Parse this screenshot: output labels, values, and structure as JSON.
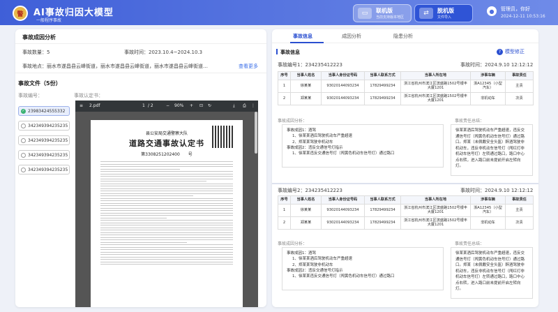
{
  "app": {
    "title": "AI事故归因大模型",
    "subtitle": "一般程序事故",
    "logo_text": "警"
  },
  "modes": [
    {
      "name": "联机版",
      "desc": "当前支持版本地区"
    },
    {
      "name": "脱机版",
      "desc": "文件导入"
    }
  ],
  "user": {
    "name": "管理员，你好",
    "time": "2024-12-11 10:53:16"
  },
  "left": {
    "title": "事故成因分析",
    "count_label": "事故数量：",
    "count_value": "5",
    "time_label": "事故时间：",
    "time_value": "2023.10.4~2024.10.3",
    "place_label": "事故地点：",
    "place_value": "丽水市遂昌县云峰街道，丽水市遂昌县云峰街道，丽水市遂昌县云峰街道…",
    "more": "查看更多",
    "files_title": "事故文件（5份）",
    "case_no_label": "事故编号：",
    "cert_label": "事故认定书：",
    "cases": [
      "23983424555332",
      "342349394235235",
      "342349394235235",
      "342349394235235",
      "342349394235235"
    ]
  },
  "viewer": {
    "filename": "2.pdf",
    "page": "1",
    "pages": "/ 2",
    "zoom": "90%",
    "doc_org": "县公安局交通警察大队",
    "doc_title": "道路交通事故认定书",
    "doc_no": "第3308251202400　　号"
  },
  "right": {
    "tabs": [
      "事故信息",
      "成因分析",
      "隐患分析"
    ],
    "section": "事故信息",
    "model_fix": "模型修正",
    "incidents": [
      {
        "no_label": "事故编号1：",
        "no": "234235412223",
        "time_label": "事故时间：",
        "time": "2024.9.10 12:12:12",
        "rows": [
          [
            "1",
            "徐某某",
            "93020144093234",
            "17829499234",
            "浙江省杭州市滨江区滨盛路1502号银丰大厦1201",
            "浙A12345（小型汽车）",
            "主责"
          ],
          [
            "2",
            "郑某某",
            "93020144093234",
            "17829499234",
            "浙江省杭州市滨江区滨盛路1502号银丰大厦1201",
            "非机动车",
            "次责"
          ]
        ],
        "analysis_label": "事故成因分析：",
        "resp_label": "事故责任总结：",
        "analysis": [
          "事故成因1：酒驾",
          "1、徐某某酒后驾驶机动车严重超速",
          "2、郑某某驾驶非机动车",
          "事故成因2：违反交通信号灯指示",
          "1、徐某某违反交通信号灯（闯黄色机动车信号灯）通过路口"
        ],
        "resp": "徐某某酒后驾驶机动车严重超速，违反交通信号灯（闯黄色机动车信号灯）通过路口。郑某（未佩戴安全头盔）醉酒驾驶非机动车，违反非机动车信号灯（闯红灯非机动车信号灯）左转通过路口，路口中心点右转，进入路口前未提前开启左转向灯。"
      },
      {
        "no_label": "事故编号2：",
        "no": "234235412223",
        "time_label": "事故时间：",
        "time": "2024.9.10 12:12:12",
        "rows": [
          [
            "1",
            "徐某某",
            "93020144093234",
            "17829499234",
            "浙江省杭州市滨江区滨盛路1502号银丰大厦1201",
            "浙A12345（小型汽车）",
            "主责"
          ],
          [
            "2",
            "郑某某",
            "93020144093234",
            "17829499234",
            "浙江省杭州市滨江区滨盛路1502号银丰大厦1201",
            "非机动车",
            "次责"
          ]
        ],
        "analysis_label": "事故成因分析：",
        "resp_label": "事故责任总结：",
        "analysis": [
          "事故成因1：酒驾",
          "1、徐某某酒后驾驶机动车严重超速",
          "2、郑某某驾驶非机动车",
          "事故成因2：违反交通信号灯指示",
          "1、徐某某违反交通信号灯（闯黄色机动车信号灯）通过路口"
        ],
        "resp": "徐某某酒后驾驶机动车严重超速，违反交通信号灯（闯黄色机动车信号灯）通过路口。郑某（未佩戴安全头盔）醉酒驾驶非机动车，违反非机动车信号灯（闯红灯非机动车信号灯）左转通过路口，路口中心点右转，进入路口前未提前开启左转向灯。"
      }
    ],
    "headers": [
      "序号",
      "当事人姓名",
      "当事人身份证号码",
      "当事人联系方式",
      "当事人所在地",
      "涉事车辆",
      "事故责任"
    ]
  }
}
